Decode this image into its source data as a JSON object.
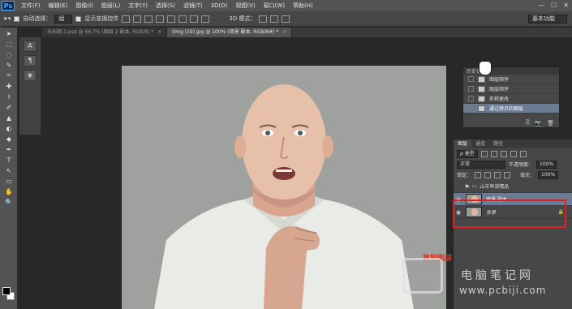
{
  "app": {
    "logo": "Ps"
  },
  "menu": [
    "文件(F)",
    "编辑(E)",
    "图像(I)",
    "图层(L)",
    "文字(Y)",
    "选择(S)",
    "滤镜(T)",
    "3D(D)",
    "视图(V)",
    "窗口(W)",
    "帮助(H)"
  ],
  "window_controls": [
    "—",
    "☐",
    "✕"
  ],
  "options": {
    "auto_select_label": "自动选择：",
    "auto_select_value": "组",
    "show_transform_label": "显示变换控件",
    "mode_3d_label": "3D 模式：",
    "workspace": "基本功能"
  },
  "tabs": [
    {
      "label": "未标题-1.psd @ 66.7% (图层 2 副本, RGB/8) *",
      "close": "×",
      "active": false
    },
    {
      "label": "timg (19).jpg @ 100% (背景 副本, RGB/8#) *",
      "close": "×",
      "active": true
    }
  ],
  "tools": [
    "➤",
    "⬚",
    "◌",
    "✎",
    "⌗",
    "✚",
    "⚕",
    "✐",
    "▲",
    "◐",
    "◆",
    "✒",
    "T",
    "↖",
    "▭",
    "✋",
    "🔍"
  ],
  "panel_strip": [
    "A",
    "¶",
    "◈"
  ],
  "history": {
    "header": "历史记录",
    "items": [
      {
        "label": "图层顺序",
        "selected": false
      },
      {
        "label": "图层顺序",
        "selected": false
      },
      {
        "label": "名称更改",
        "selected": false
      },
      {
        "label": "通过拷贝的图层",
        "selected": true
      }
    ],
    "footer_icons": [
      "⎘",
      "📷",
      "🗑"
    ]
  },
  "layers": {
    "tabs": [
      "图层",
      "通道",
      "路径"
    ],
    "filter_label": "ρ 类型",
    "blend_mode": "正常",
    "opacity_label": "不透明度：",
    "opacity_value": "100%",
    "lock_label": "锁定：",
    "fill_label": "填充：",
    "fill_value": "100%",
    "items": [
      {
        "name": "山羊早读精品",
        "group": true,
        "visible": false,
        "selected": false
      },
      {
        "name": "背景 副本",
        "group": false,
        "visible": true,
        "selected": true
      },
      {
        "name": "背景",
        "group": false,
        "visible": true,
        "selected": false,
        "locked": true
      }
    ]
  },
  "annotation": "复制图层",
  "watermark": {
    "cn": "电脑笔记网",
    "url": "www.pcbiji.com"
  },
  "colors": {
    "highlight": "#6b7c92",
    "annotation_red": "#e02020",
    "canvas_bg": "#9ea19e"
  }
}
